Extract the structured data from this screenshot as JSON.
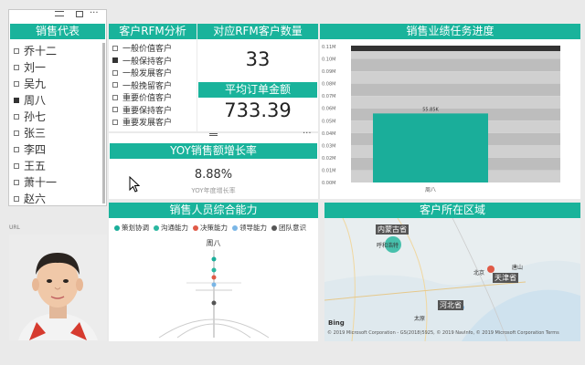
{
  "rep_list": {
    "title": "销售代表",
    "items": [
      {
        "name": "乔十二",
        "selected": false
      },
      {
        "name": "刘一",
        "selected": false
      },
      {
        "name": "吴九",
        "selected": false
      },
      {
        "name": "周八",
        "selected": true
      },
      {
        "name": "孙七",
        "selected": false
      },
      {
        "name": "张三",
        "selected": false
      },
      {
        "name": "李四",
        "selected": false
      },
      {
        "name": "王五",
        "selected": false
      },
      {
        "name": "萧十一",
        "selected": false
      },
      {
        "name": "赵六",
        "selected": false
      }
    ]
  },
  "rfm": {
    "title": "客户RFM分析",
    "items": [
      {
        "label": "一般价值客户",
        "selected": false
      },
      {
        "label": "一般保持客户",
        "selected": true
      },
      {
        "label": "一般发展客户",
        "selected": false
      },
      {
        "label": "一般挽留客户",
        "selected": false
      },
      {
        "label": "重要价值客户",
        "selected": false
      },
      {
        "label": "重要保持客户",
        "selected": false
      },
      {
        "label": "重要发展客户",
        "selected": false
      }
    ]
  },
  "rfm_count": {
    "title": "对应RFM客户数量",
    "value": "33"
  },
  "avg_order": {
    "title": "平均订单金额",
    "value": "733.39"
  },
  "yoy": {
    "title": "YOY销售额增长率",
    "value": "8.88%",
    "caption": "YOY年度增长率"
  },
  "photo": {
    "label": "URL"
  },
  "colors": {
    "accent": "#19b39b",
    "bar_fill": "#1aae9a",
    "target_bar": "#333333"
  },
  "progress": {
    "title": "销售业绩任务进度",
    "chart_data": {
      "type": "bar",
      "categories": [
        "周八"
      ],
      "values": [
        55.85
      ],
      "value_label": "55.85K",
      "target": 110,
      "yticks": [
        "0.11M",
        "0.10M",
        "0.09M",
        "0.08M",
        "0.07M",
        "0.06M",
        "0.05M",
        "0.04M",
        "0.03M",
        "0.02M",
        "0.01M",
        "0.00M"
      ],
      "ylim": [
        0,
        110
      ]
    }
  },
  "ability": {
    "title": "销售人员综合能力",
    "legend": [
      {
        "label": "策划协调",
        "color": "#1aae9a"
      },
      {
        "label": "沟通能力",
        "color": "#2ab7a0"
      },
      {
        "label": "决策能力",
        "color": "#e05a47"
      },
      {
        "label": "领导能力",
        "color": "#7ab6e6"
      },
      {
        "label": "团队意识",
        "color": "#555555"
      }
    ],
    "axis_label": "周八"
  },
  "region": {
    "title": "客户所在区域",
    "labels": {
      "nmg": "内蒙古省",
      "tj": "天津省",
      "hb": "河北省",
      "hhht": "呼和浩特",
      "bj": "北京",
      "ts": "唐山",
      "ty": "太原"
    },
    "bing": "Bing",
    "copyright": "© 2019 Microsoft Corporation - GS(2018)5925, © 2019 NavInfo, © 2019 Microsoft Corporation Terms"
  }
}
